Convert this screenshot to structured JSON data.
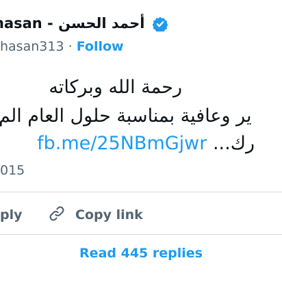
{
  "tweet": {
    "author_name": "أحمد الحسن - hasan",
    "handle": "hasan313",
    "separator": "·",
    "follow_label": "Follow",
    "body_line1": "رحمة الله وبركاته",
    "body_line2": "ير وعافية بمناسبة حلول العام الم",
    "body_line3_text": "رك...",
    "link_text": "fb.me/25NBmGjwr",
    "date": "015"
  },
  "actions": {
    "reply_label": "ply",
    "copy_link_label": "Copy link",
    "read_replies_label": "Read 445 replies"
  },
  "colors": {
    "link_blue": "#1d9bf0",
    "muted_gray": "#536471",
    "divider": "#cfd9de"
  },
  "icons": [
    "verified-badge-icon",
    "link-icon"
  ]
}
